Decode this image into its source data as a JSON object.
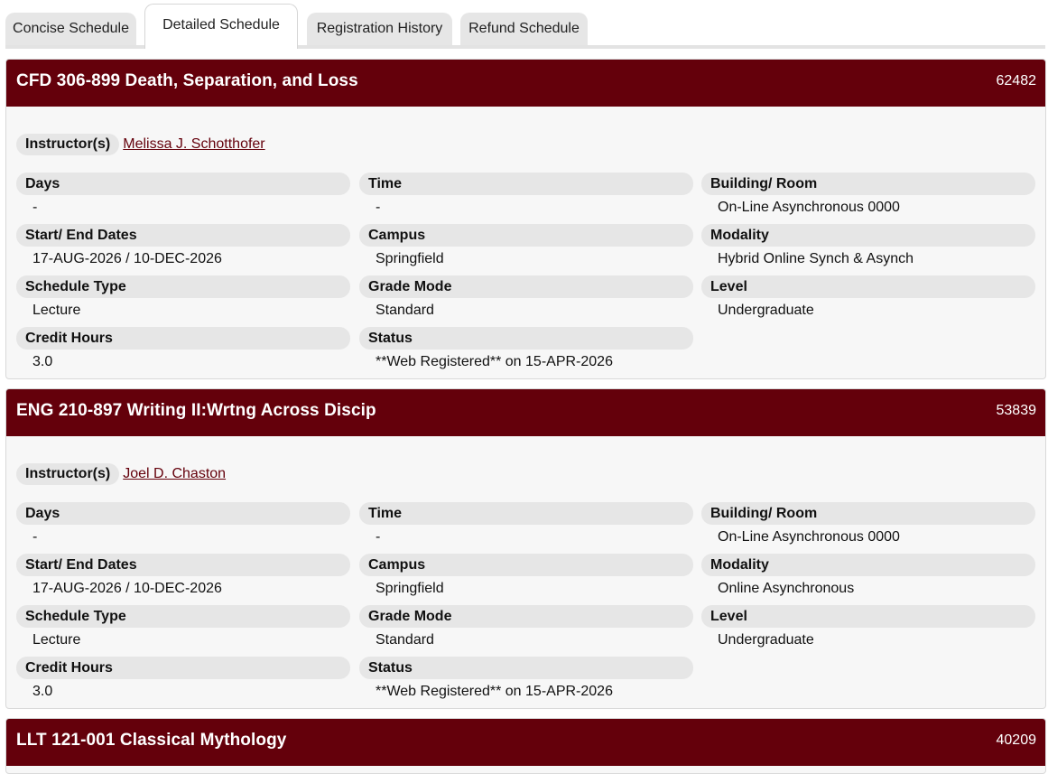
{
  "tabs": [
    {
      "label": "Concise Schedule",
      "active": false
    },
    {
      "label": "Detailed Schedule",
      "active": true
    },
    {
      "label": "Registration History",
      "active": false
    },
    {
      "label": "Refund Schedule",
      "active": false
    }
  ],
  "colors": {
    "header_bg": "#64000b",
    "pill_bg": "#e6e6e6",
    "link": "#64000b"
  },
  "labels": {
    "instructors": "Instructor(s)",
    "days": "Days",
    "time": "Time",
    "building_room": "Building/ Room",
    "start_end_dates": "Start/ End Dates",
    "campus": "Campus",
    "modality": "Modality",
    "schedule_type": "Schedule Type",
    "grade_mode": "Grade Mode",
    "level": "Level",
    "credit_hours": "Credit Hours",
    "status": "Status"
  },
  "courses": [
    {
      "title": "CFD 306-899 Death, Separation, and Loss",
      "crn": "62482",
      "instructor": "Melissa J. Schotthofer",
      "days": "-",
      "time": "-",
      "building_room": "On-Line Asynchronous 0000",
      "start_end_dates": "17-AUG-2026 / 10-DEC-2026",
      "campus": "Springfield",
      "modality": "Hybrid Online Synch & Asynch",
      "schedule_type": "Lecture",
      "grade_mode": "Standard",
      "level": "Undergraduate",
      "credit_hours": "3.0",
      "status": "**Web Registered** on 15-APR-2026"
    },
    {
      "title": "ENG 210-897 Writing II:Wrtng Across Discip",
      "crn": "53839",
      "instructor": "Joel D. Chaston",
      "days": "-",
      "time": "-",
      "building_room": "On-Line Asynchronous 0000",
      "start_end_dates": "17-AUG-2026 / 10-DEC-2026",
      "campus": "Springfield",
      "modality": "Online Asynchronous",
      "schedule_type": "Lecture",
      "grade_mode": "Standard",
      "level": "Undergraduate",
      "credit_hours": "3.0",
      "status": "**Web Registered** on 15-APR-2026"
    },
    {
      "title": "LLT 121-001 Classical Mythology",
      "crn": "40209"
    }
  ]
}
